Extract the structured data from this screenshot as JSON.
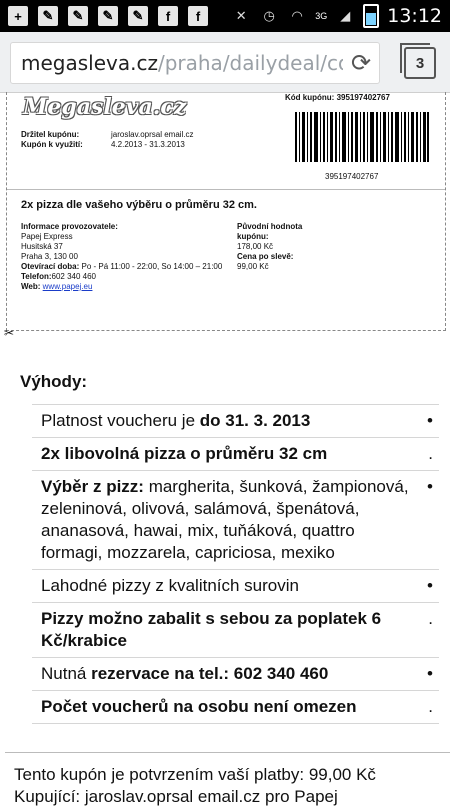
{
  "statusbar": {
    "network": "3G",
    "time": "13:12",
    "icons": [
      "plus-icon",
      "chat-icon",
      "chat-icon",
      "chat-icon",
      "chat-icon",
      "facebook-icon",
      "facebook-icon",
      "mute-icon",
      "alarm-icon",
      "wifi-icon",
      "signal-icon",
      "battery-icon"
    ]
  },
  "browser": {
    "url_domain": "megasleva.cz",
    "url_rest": "/praha/dailydeal/coupo",
    "tab_count": "3"
  },
  "coupon": {
    "logo": "Megasleva.cz",
    "code_label": "Kód kupónu:",
    "code_value": "395197402767",
    "barcode_number": "395197402767",
    "holder_label": "Držitel kupónu:",
    "holder_value": "jaroslav.oprsal email.cz",
    "use_label": "Kupón k využití:",
    "use_value": "4.2.2013 - 31.3.2013",
    "deal_title": "2x pizza dle vašeho výběru o průměru 32 cm.",
    "provider_label": "Informace provozovatele:",
    "provider_name": "Papej Express",
    "provider_street": "Husitská 37",
    "provider_city": "Praha 3, 130 00",
    "hours_label": "Otevírací doba:",
    "hours_value": "Po - Pá 11:00 - 22:00, So 14:00 – 21:00",
    "phone_label": "Telefon:",
    "phone_value": "602 340 460",
    "web_label": "Web:",
    "web_value": "www.papej.eu",
    "orig_label": "Původní hodnota kupónu:",
    "orig_value": "178,00 Kč",
    "price_label": "Cena po slevě:",
    "price_value": "99,00 Kč"
  },
  "benefits": {
    "title": "Výhody:",
    "items": [
      {
        "pre": "Platnost voucheru je ",
        "bold": "do 31. 3. 2013",
        "post": "",
        "bullet": "•"
      },
      {
        "pre": "",
        "bold": "2x libovolná pizza o průměru 32 cm",
        "post": "",
        "bullet": "."
      },
      {
        "pre": "",
        "bold": "Výběr z pizz:",
        "post": " margherita, šunková, žampionová, zeleninová, olivová, salámová, špenátová, ananasová, hawai, mix, tuňáková, quattro formagi, mozzarela, capriciosa, mexiko",
        "bullet": "•"
      },
      {
        "pre": "Lahodné pizzy z kvalitních surovin",
        "bold": "",
        "post": "",
        "bullet": "•"
      },
      {
        "pre": "",
        "bold": "Pizzy možno zabalit s sebou za poplatek 6 Kč/krabice",
        "post": "",
        "bullet": "."
      },
      {
        "pre": "Nutná ",
        "bold": "rezervace na tel.: 602 340 460",
        "post": "",
        "bullet": "•"
      },
      {
        "pre": "",
        "bold": "Počet voucherů na osobu není omezen",
        "post": "",
        "bullet": "."
      }
    ]
  },
  "footer": {
    "line1": "Tento kupón je potvrzením vaší platby: 99,00 Kč",
    "line2": "Kupující: jaroslav.oprsal email.cz pro Papej"
  }
}
